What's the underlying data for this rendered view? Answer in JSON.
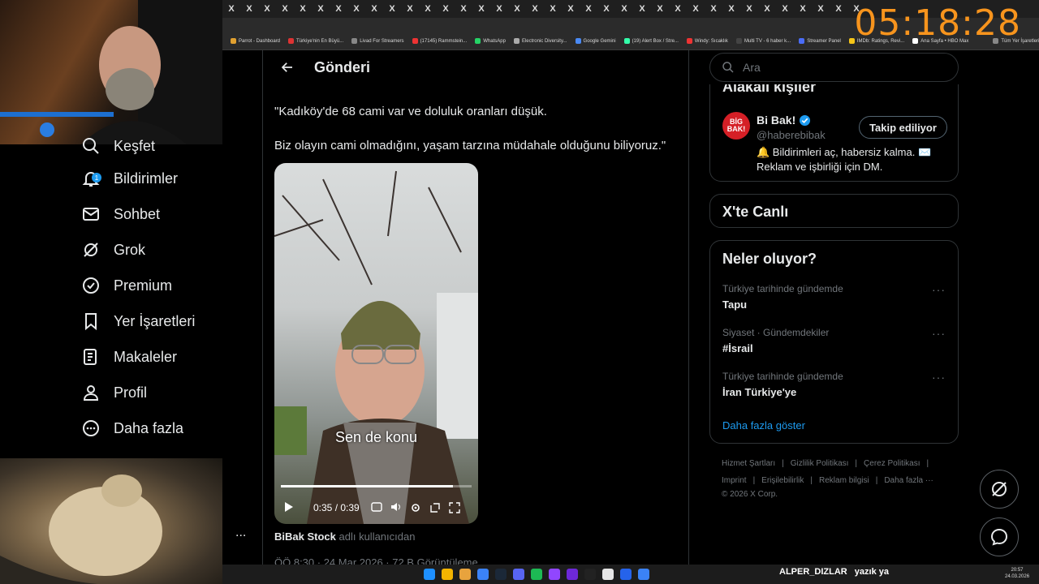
{
  "overlay": {
    "timer": "05:18:28",
    "chat_user": "ALPER_DIZLAR",
    "chat_message": "yazık ya"
  },
  "browser": {
    "bookmarks": [
      "Parrot - Dashboard",
      "Türkiye'nin En Büyü...",
      "Livad For Streamers",
      "(17145) Rammstein...",
      "WhatsApp",
      "Electronic Diversity...",
      "Google Gemini",
      "(19) Alert Box / Stre...",
      "Windy: Sıcaklık",
      "Multi TV - 6 haber k...",
      "Streamer Panel",
      "IMDb: Ratings, Revi...",
      "Ana Sayfa • HBO Max",
      "Tüm Yer İşaretleri"
    ],
    "bookmark_colors": [
      "#e0a030",
      "#d33",
      "#888",
      "#e33",
      "#25d366",
      "#aaa",
      "#4a8af4",
      "#3fa",
      "#e33",
      "#444",
      "#4a6cf7",
      "#f5c518",
      "#fff",
      "#888"
    ]
  },
  "nav": {
    "partial_label": "Keşfet",
    "notification_badge": "1",
    "items": [
      {
        "label": "Bildirimler",
        "icon": "bell-icon"
      },
      {
        "label": "Sohbet",
        "icon": "mail-icon"
      },
      {
        "label": "Grok",
        "icon": "grok-icon"
      },
      {
        "label": "Premium",
        "icon": "verified-icon"
      },
      {
        "label": "Yer İşaretleri",
        "icon": "bookmark-icon"
      },
      {
        "label": "Makaleler",
        "icon": "article-icon"
      },
      {
        "label": "Profil",
        "icon": "person-icon"
      },
      {
        "label": "Daha fazla",
        "icon": "more-circle-icon"
      }
    ],
    "account_more": "..."
  },
  "post": {
    "header_title": "Gönderi",
    "text_line1": "\"Kadıköy'de 68 cami var ve doluluk oranları düşük.",
    "text_line2": "Biz olayın cami olmadığını, yaşam tarzına müdahale olduğunu biliyoruz.\"",
    "video": {
      "caption": "Sen de konu",
      "time": "0:35 / 0:39",
      "progress": 0.9
    },
    "author_name": "BiBak Stock",
    "author_suffix": "adlı kullanıcıdan",
    "meta": "ÖÖ 8:30 · 24 Mar 2026 · 72 B Görüntüleme"
  },
  "sidebar": {
    "search_placeholder": "Ara",
    "people_title": "Alakalı kişiler",
    "person": {
      "logo": "BİG BAK!",
      "name": "Bi Bak!",
      "handle": "@haberebibak",
      "follow_label": "Takip ediliyor",
      "bio_line1": "🔔 Bildirimleri aç, habersiz kalma. ✉️",
      "bio_line2": "Reklam ve işbirliği için DM."
    },
    "live_title": "X'te Canlı",
    "trends_title": "Neler oluyor?",
    "trends": [
      {
        "category": "Türkiye tarihinde gündemde",
        "name": "Tapu"
      },
      {
        "category": "Siyaset · Gündemdekiler",
        "name": "#İsrail"
      },
      {
        "category": "Türkiye tarihinde gündemde",
        "name": "İran Türkiye'ye"
      }
    ],
    "show_more": "Daha fazla göster",
    "footer_row1": [
      "Hizmet Şartları",
      "|",
      "Gizlilik Politikası",
      "|",
      "Çerez Politikası",
      "|"
    ],
    "footer_row2": [
      "Imprint",
      "|",
      "Erişilebilirlik",
      "|",
      "Reklam bilgisi",
      "|",
      "Daha fazla ···"
    ],
    "copyright": "© 2026 X Corp."
  },
  "taskbar": {
    "clock_time": "20:57",
    "clock_date": "24.03.2026"
  }
}
